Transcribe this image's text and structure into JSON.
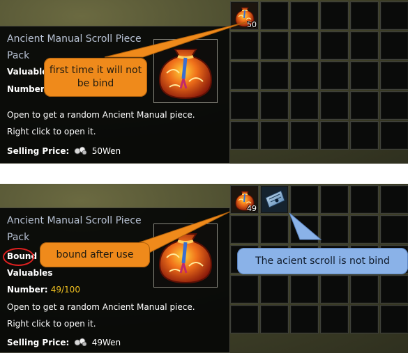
{
  "top": {
    "slots": [
      {
        "icon": "fortune-bag-icon",
        "count": "50"
      }
    ],
    "tooltip": {
      "title": "Ancient Manual Scroll Piece Pack",
      "category": "Valuables",
      "number_label": "Number:",
      "number_value": "",
      "desc1": "Open to get a random Ancient Manual piece.",
      "desc2": "Right click to open it.",
      "price_label": "Selling Price:",
      "price_value": "50Wen"
    },
    "callout": "first time it will not be bind"
  },
  "bottom": {
    "slots": [
      {
        "icon": "fortune-bag-icon",
        "count": "49"
      },
      {
        "icon": "scroll-icon",
        "count": ""
      }
    ],
    "tooltip": {
      "title": "Ancient Manual Scroll Piece Pack",
      "bound": "Bound",
      "category": "Valuables",
      "number_label": "Number:",
      "number_value": "49/100",
      "desc1": "Open to get a random Ancient Manual piece.",
      "desc2": "Right click to open it.",
      "price_label": "Selling Price:",
      "price_value": "49Wen"
    },
    "callout_bound": "bound after use",
    "callout_scroll": "The acient scroll is not bind"
  },
  "colors": {
    "callout_orange": "#ef8a1b",
    "callout_blue": "#8ab2e8",
    "highlight_yellow": "#f0c020",
    "bound_ring": "#e02020"
  }
}
